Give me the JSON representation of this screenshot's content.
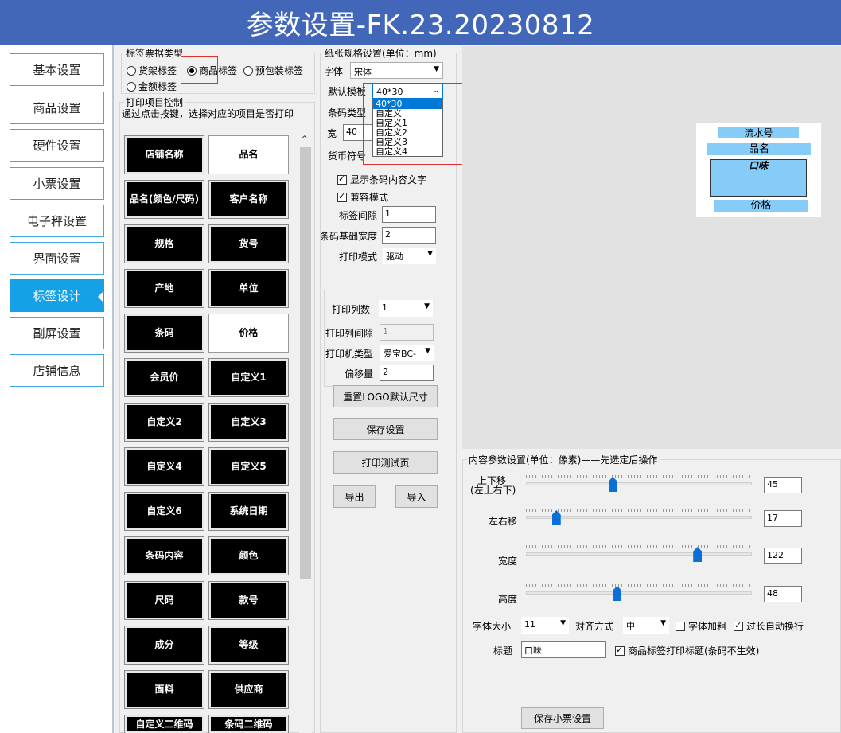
{
  "window": {
    "title": "参数设置-FK.23.20230812"
  },
  "sidebar": {
    "items": [
      {
        "label": "基本设置"
      },
      {
        "label": "商品设置"
      },
      {
        "label": "硬件设置"
      },
      {
        "label": "小票设置"
      },
      {
        "label": "电子秤设置"
      },
      {
        "label": "界面设置"
      },
      {
        "label": "标签设计"
      },
      {
        "label": "副屏设置"
      },
      {
        "label": "店铺信息"
      }
    ]
  },
  "label_type": {
    "title": "标签票据类型",
    "options": [
      "货架标签",
      "商品标签",
      "预包装标签",
      "金额标签"
    ],
    "selected": "商品标签"
  },
  "print_items": {
    "title": "打印项目控制",
    "hint": "通过点击按键，选择对应的项目是否打印",
    "items": [
      "店铺名称",
      "品名",
      "品名(颜色/尺码)",
      "客户名称",
      "规格",
      "货号",
      "产地",
      "单位",
      "条码",
      "价格",
      "会员价",
      "自定义1",
      "自定义2",
      "自定义3",
      "自定义4",
      "自定义5",
      "自定义6",
      "系统日期",
      "条码内容",
      "颜色",
      "尺码",
      "款号",
      "成分",
      "等级",
      "面料",
      "供应商",
      "自定义二维码",
      "条码二维码"
    ]
  },
  "paper": {
    "title": "纸张规格设置(单位：mm)",
    "font_label": "字体",
    "font_value": "宋体",
    "template_label": "默认模板",
    "template_value": "40*30",
    "template_options": [
      "40*30",
      "自定义",
      "自定义1",
      "自定义2",
      "自定义3",
      "自定义4"
    ],
    "barcode_type_label": "条码类型",
    "width_label": "宽",
    "width_value": "40",
    "currency_label": "货币符号",
    "show_barcode_text": "显示条码内容文字",
    "compat_mode": "兼容模式",
    "gap_label": "标签间隙",
    "gap_value": "1",
    "barcode_base_label": "条码基础宽度",
    "barcode_base_value": "2",
    "print_mode_label": "打印模式",
    "print_mode_value": "驱动",
    "columns_label": "打印列数",
    "columns_value": "1",
    "col_gap_label": "打印列间隙",
    "col_gap_value": "1",
    "printer_type_label": "打印机类型",
    "printer_type_value": "爱宝BC-",
    "offset_label": "偏移量",
    "offset_value": "2",
    "reset_logo": "重置LOGO默认尺寸",
    "save": "保存设置",
    "test_print": "打印测试页",
    "export": "导出",
    "import": "导入"
  },
  "preview": {
    "serial": "流水号",
    "name": "品名",
    "flavor": "口味",
    "price": "价格"
  },
  "content_params": {
    "title": "内容参数设置(单位：像素)——先选定后操作",
    "updown_label_1": "上下移",
    "updown_label_2": "(左上右下)",
    "updown_value": "45",
    "updown_level": 0.38,
    "leftright_label": "左右移",
    "leftright_value": "17",
    "leftright_level": 0.12,
    "width_label": "宽度",
    "width_value": "122",
    "width_level": 0.77,
    "height_label": "高度",
    "height_value": "48",
    "height_level": 0.4,
    "font_size_label": "字体大小",
    "font_size_value": "11",
    "align_label": "对齐方式",
    "align_value": "中",
    "bold_label": "字体加粗",
    "wrap_label": "过长自动换行",
    "title_label": "标题",
    "title_value": "口味",
    "print_title_label": "商品标签打印标题(条码不生效)",
    "save_receipt": "保存小票设置"
  }
}
